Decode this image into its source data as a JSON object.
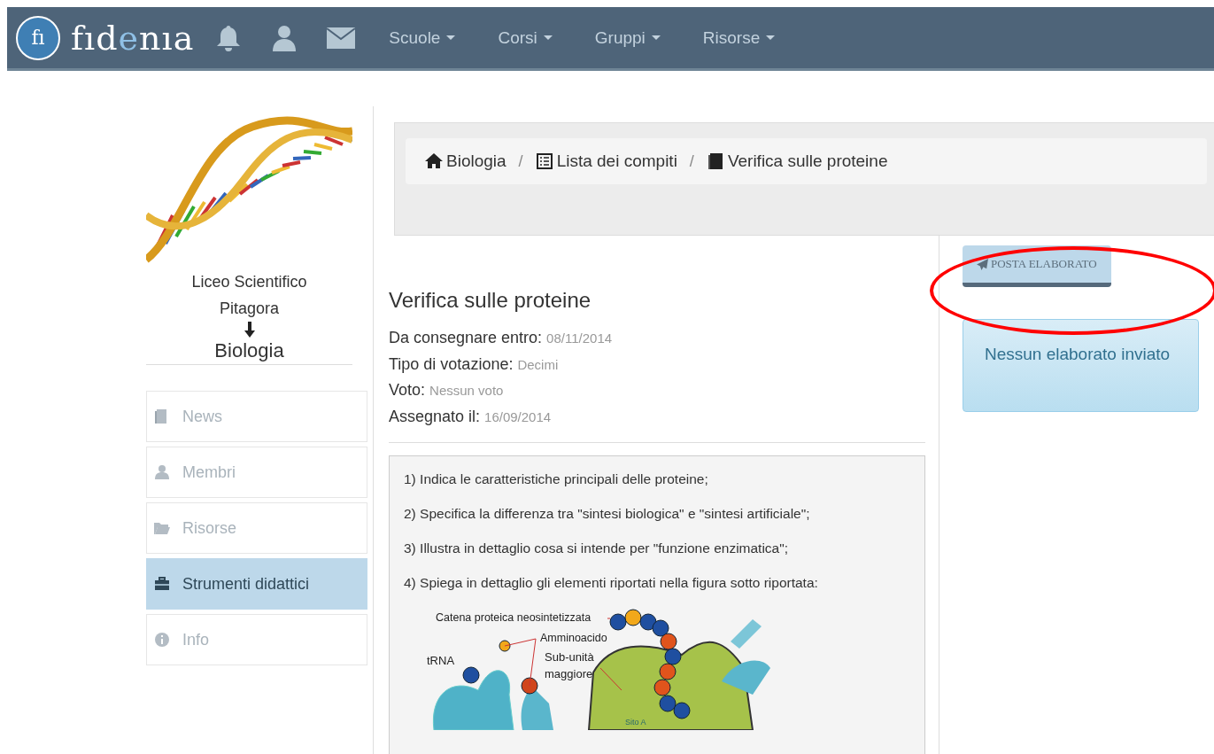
{
  "navbar": {
    "logo_mark": "fı",
    "logo_parts": [
      {
        "text": "fıd",
        "accent": false
      },
      {
        "text": "e",
        "accent": true
      },
      {
        "text": "nıa",
        "accent": false
      }
    ],
    "menus": [
      "Scuole",
      "Corsi",
      "Gruppi",
      "Risorse"
    ]
  },
  "sidebar": {
    "school": "Liceo Scientifico Pitagora",
    "course": "Biologia",
    "items": [
      {
        "label": "News",
        "selected": false
      },
      {
        "label": "Membri",
        "selected": false
      },
      {
        "label": "Risorse",
        "selected": false
      },
      {
        "label": "Strumenti didattici",
        "selected": true
      },
      {
        "label": "Info",
        "selected": false
      }
    ]
  },
  "breadcrumb": [
    {
      "label": "Biologia"
    },
    {
      "separator": "/",
      "label": "Lista dei compiti"
    },
    {
      "separator": "/",
      "label": "Verifica sulle proteine"
    }
  ],
  "assignment": {
    "title": "Verifica sulle proteine",
    "fields": [
      {
        "label": "Da consegnare entro:",
        "value": "08/11/2014"
      },
      {
        "label": "Tipo di votazione:",
        "value": "Decimi"
      },
      {
        "label": "Voto:",
        "value": "Nessun voto"
      },
      {
        "label": "Assegnato il:",
        "value": "16/09/2014"
      }
    ],
    "questions": [
      "1) Indica le caratteristiche principali delle proteine;",
      "2) Specifica la differenza tra \"sintesi biologica\" e \"sintesi artificiale\";",
      "3) Illustra in dettaglio cosa si intende per \"funzione enzimatica\";",
      "4) Spiega in dettaglio gli elementi riportati nella figura sotto riportata:"
    ],
    "figure_labels": [
      "Catena proteica neosintetizzata",
      "Amminoacido",
      "tRNA",
      "Sub-unità maggiore",
      "Sito A"
    ]
  },
  "submit_button": "POSTA ELABORATO",
  "alert": "Nessun elaborato inviato"
}
